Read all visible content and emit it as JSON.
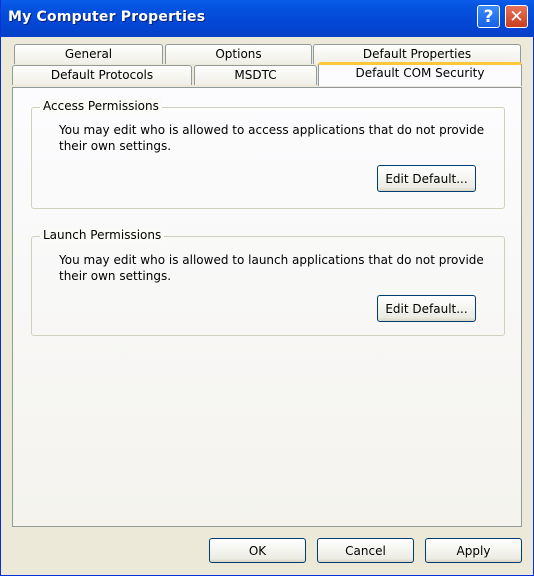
{
  "window": {
    "title": "My Computer Properties"
  },
  "titlebar": {
    "help_glyph": "?",
    "close_glyph": "✕"
  },
  "tabs": [
    {
      "label": "General"
    },
    {
      "label": "Options"
    },
    {
      "label": "Default Properties"
    },
    {
      "label": "Default Protocols"
    },
    {
      "label": "MSDTC"
    },
    {
      "label": "Default COM Security"
    }
  ],
  "active_tab": "Default COM Security",
  "access": {
    "title": "Access Permissions",
    "text": "You may edit who is allowed to access applications that do not provide their own settings.",
    "button": "Edit Default..."
  },
  "launch": {
    "title": "Launch Permissions",
    "text": "You may edit who is allowed to launch applications that do not provide their own settings.",
    "button": "Edit Default..."
  },
  "footer": {
    "ok": "OK",
    "cancel": "Cancel",
    "apply": "Apply"
  }
}
